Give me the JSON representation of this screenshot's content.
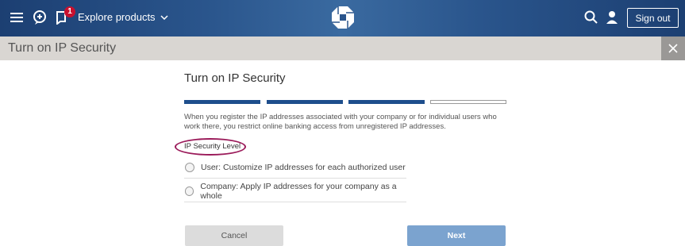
{
  "header": {
    "notification_count": "1",
    "explore_label": "Explore products",
    "sign_out_label": "Sign out"
  },
  "titlebar": {
    "title": "Turn on IP Security"
  },
  "main": {
    "heading": "Turn on IP Security",
    "progress": {
      "completed_steps": 3,
      "total_steps": 4
    },
    "description": "When you register the IP addresses associated with your company or for individual users who work there, you restrict online banking access from unregistered IP addresses.",
    "section_label": "IP Security Level",
    "options": [
      {
        "label": "User: Customize IP addresses for each authorized user"
      },
      {
        "label": "Company: Apply IP addresses for your company as a whole"
      }
    ],
    "cancel_label": "Cancel",
    "next_label": "Next"
  },
  "colors": {
    "header_bg": "#2a558c",
    "progress_filled": "#1e4e8c",
    "annotation_circle": "#9b1b5a",
    "next_button": "#7ba3cf"
  }
}
